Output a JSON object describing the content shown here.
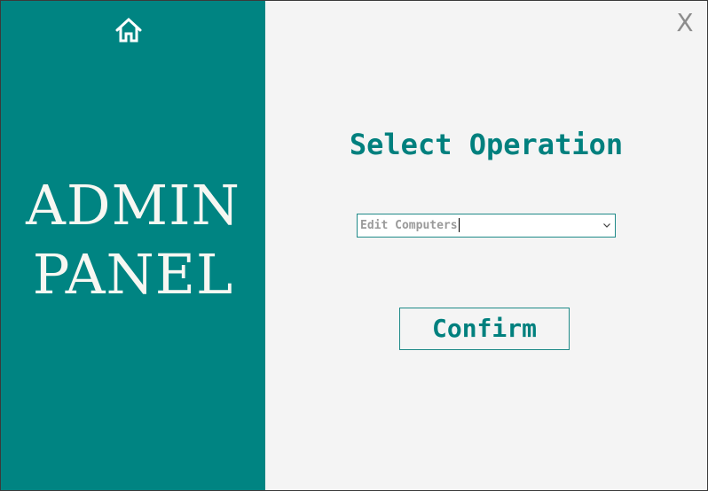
{
  "sidebar": {
    "home_icon": "home-icon",
    "brand_line1": "ADMIN",
    "brand_line2": "PANEL",
    "background": "#008482"
  },
  "window": {
    "close_label": "X"
  },
  "main": {
    "heading": "Select Operation",
    "operation_select": {
      "value": "Edit Computers",
      "icon": "chevron-down-icon"
    },
    "confirm_label": "Confirm",
    "accent": "#00807e"
  }
}
